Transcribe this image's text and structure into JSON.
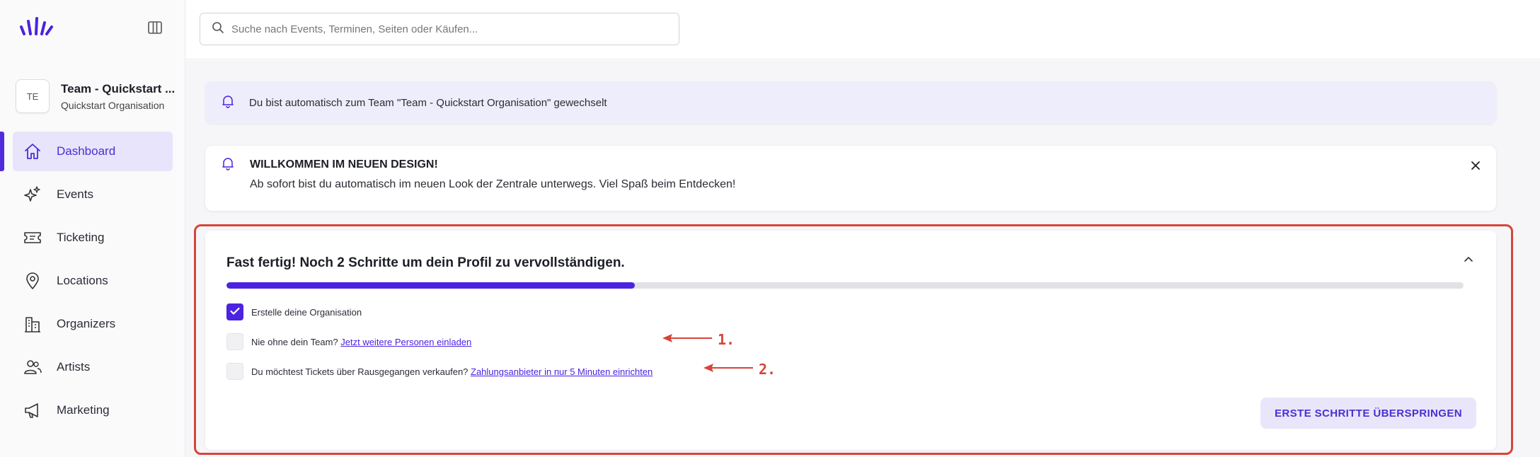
{
  "app": {
    "brand_color": "#4b23e0"
  },
  "team": {
    "avatar_initials": "TE",
    "name": "Team - Quickstart ...",
    "organisation": "Quickstart Organisation"
  },
  "sidebar": {
    "items": [
      {
        "label": "Dashboard",
        "icon": "home-icon",
        "active": true
      },
      {
        "label": "Events",
        "icon": "sparkles-icon"
      },
      {
        "label": "Ticketing",
        "icon": "ticket-icon"
      },
      {
        "label": "Locations",
        "icon": "map-pin-icon"
      },
      {
        "label": "Organizers",
        "icon": "building-icon"
      },
      {
        "label": "Artists",
        "icon": "users-icon"
      },
      {
        "label": "Marketing",
        "icon": "megaphone-icon"
      }
    ]
  },
  "search": {
    "placeholder": "Suche nach Events, Terminen, Seiten oder Käufen..."
  },
  "notices": {
    "team_switch": "Du bist automatisch zum Team \"Team - Quickstart Organisation\" gewechselt",
    "welcome_title": "WILLKOMMEN IM NEUEN DESIGN!",
    "welcome_body": "Ab sofort bist du automatisch im neuen Look der Zentrale unterwegs. Viel Spaß beim Entdecken!"
  },
  "onboarding": {
    "title": "Fast fertig! Noch 2 Schritte um dein Profil zu vervollständigen.",
    "progress_percent": 33,
    "steps": [
      {
        "text": "Erstelle deine Organisation",
        "link": "",
        "done": true
      },
      {
        "text": "Nie ohne dein Team? ",
        "link": "Jetzt weitere Personen einladen",
        "done": false
      },
      {
        "text": "Du möchtest Tickets über Rausgegangen verkaufen? ",
        "link": "Zahlungsanbieter in nur 5 Minuten einrichten",
        "done": false
      }
    ],
    "skip_label": "ERSTE SCHRITTE ÜBERSPRINGEN"
  },
  "annotations": {
    "first": "1.",
    "second": "2.",
    "color": "#d6453a"
  }
}
